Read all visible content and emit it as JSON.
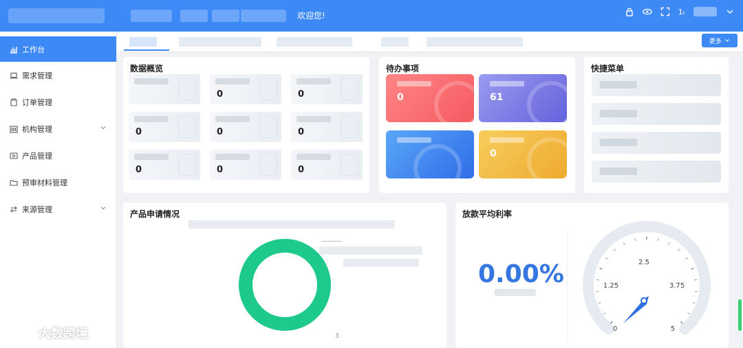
{
  "header": {
    "welcome": "欢迎您!",
    "icons": [
      "lock-icon",
      "eye-icon",
      "fullscreen-icon",
      "font-size-icon",
      "chevron-down-icon"
    ],
    "font_toggle": "1ₜ"
  },
  "sidebar": {
    "items": [
      {
        "label": "工作台",
        "icon": "chart-icon",
        "active": true
      },
      {
        "label": "需求管理",
        "icon": "laptop-icon"
      },
      {
        "label": "订单管理",
        "icon": "clipboard-icon"
      },
      {
        "label": "机构管理",
        "icon": "building-icon",
        "expandable": true
      },
      {
        "label": "产品管理",
        "icon": "id-card-icon"
      },
      {
        "label": "预审材料管理",
        "icon": "folder-icon"
      },
      {
        "label": "来源管理",
        "icon": "swap-icon",
        "expandable": true
      }
    ]
  },
  "watermark": {
    "text": "大数跨境"
  },
  "tabbar": {
    "more_label": "更多"
  },
  "overview": {
    "title": "数据概览",
    "values": [
      "",
      "0",
      "0",
      "0",
      "0",
      "0",
      "0",
      "0",
      "0"
    ]
  },
  "todo": {
    "title": "待办事项",
    "values": [
      "0",
      "61",
      "",
      "0"
    ],
    "colors": [
      "#f8666b",
      "#7272e0",
      "#3b82f0",
      "#f1b641"
    ]
  },
  "quick_menu": {
    "title": "快捷菜单"
  },
  "apply": {
    "title": "产品申请情况",
    "donut_color": "#1ec98c",
    "bottom_label": "3"
  },
  "rate": {
    "title": "放款平均利率",
    "value": "0.00%",
    "gauge": {
      "min": 0,
      "max": 5,
      "value": 0,
      "ticks": [
        "0",
        "1.25",
        "2.5",
        "3.75",
        "5"
      ]
    }
  },
  "colors": {
    "accent": "#3d8af7",
    "scroll_thumb": "#3ccf71"
  }
}
